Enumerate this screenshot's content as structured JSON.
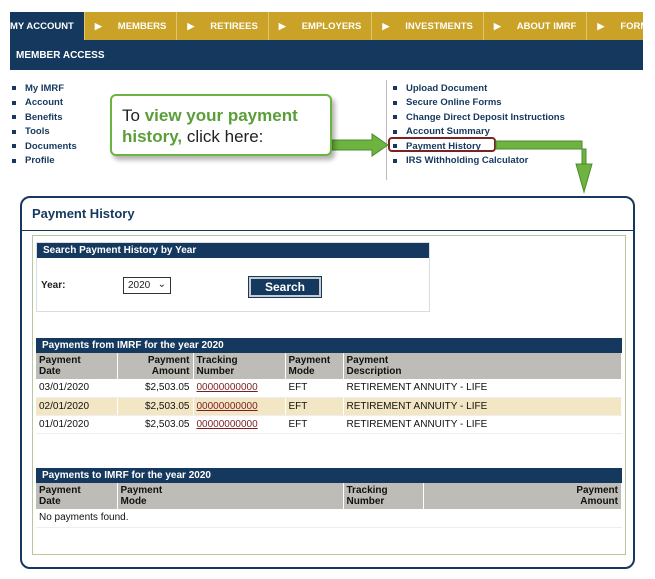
{
  "nav": {
    "active": "MY ACCOUNT",
    "items": [
      "MEMBERS",
      "RETIREES",
      "EMPLOYERS",
      "INVESTMENTS",
      "ABOUT IMRF",
      "FORMS AND"
    ]
  },
  "member_access": "MEMBER ACCESS",
  "left_links": [
    "My IMRF",
    "Account",
    "Benefits",
    "Tools",
    "Documents",
    "Profile"
  ],
  "right_links": [
    "Upload Document",
    "Secure Online Forms",
    "Change Direct Deposit Instructions",
    "Account Summary",
    "Payment History",
    "IRS Withholding Calculator"
  ],
  "callout": {
    "prefix": "To ",
    "highlight": "view your payment history,",
    "suffix": " click here:"
  },
  "panel": {
    "title": "Payment History",
    "search": {
      "header": "Search Payment History by Year",
      "year_label": "Year:",
      "year_value": "2020",
      "button": "Search"
    },
    "from_table": {
      "header": "Payments from IMRF for the year 2020",
      "columns": [
        [
          "Payment",
          "Date"
        ],
        [
          "Payment",
          "Amount"
        ],
        [
          "Tracking",
          "Number"
        ],
        [
          "Payment",
          "Mode"
        ],
        [
          "Payment",
          "Description"
        ]
      ],
      "rows": [
        [
          "03/01/2020",
          "$2,503.05",
          "00000000000",
          "EFT",
          "RETIREMENT ANNUITY - LIFE"
        ],
        [
          "02/01/2020",
          "$2,503.05",
          "00000000000",
          "EFT",
          "RETIREMENT ANNUITY - LIFE"
        ],
        [
          "01/01/2020",
          "$2,503.05",
          "00000000000",
          "EFT",
          "RETIREMENT ANNUITY - LIFE"
        ]
      ]
    },
    "to_table": {
      "header": "Payments to IMRF for the year 2020",
      "columns": [
        [
          "Payment",
          "Date"
        ],
        [
          "Payment",
          "Mode"
        ],
        [
          "Tracking",
          "Number"
        ],
        [
          "Payment",
          "Amount"
        ]
      ],
      "empty": "No payments found."
    }
  },
  "colors": {
    "navy": "#15395e",
    "gold": "#c9a227",
    "green": "#6db33f",
    "highlight_row": "#f3e6c4",
    "maroon": "#7b2222"
  }
}
